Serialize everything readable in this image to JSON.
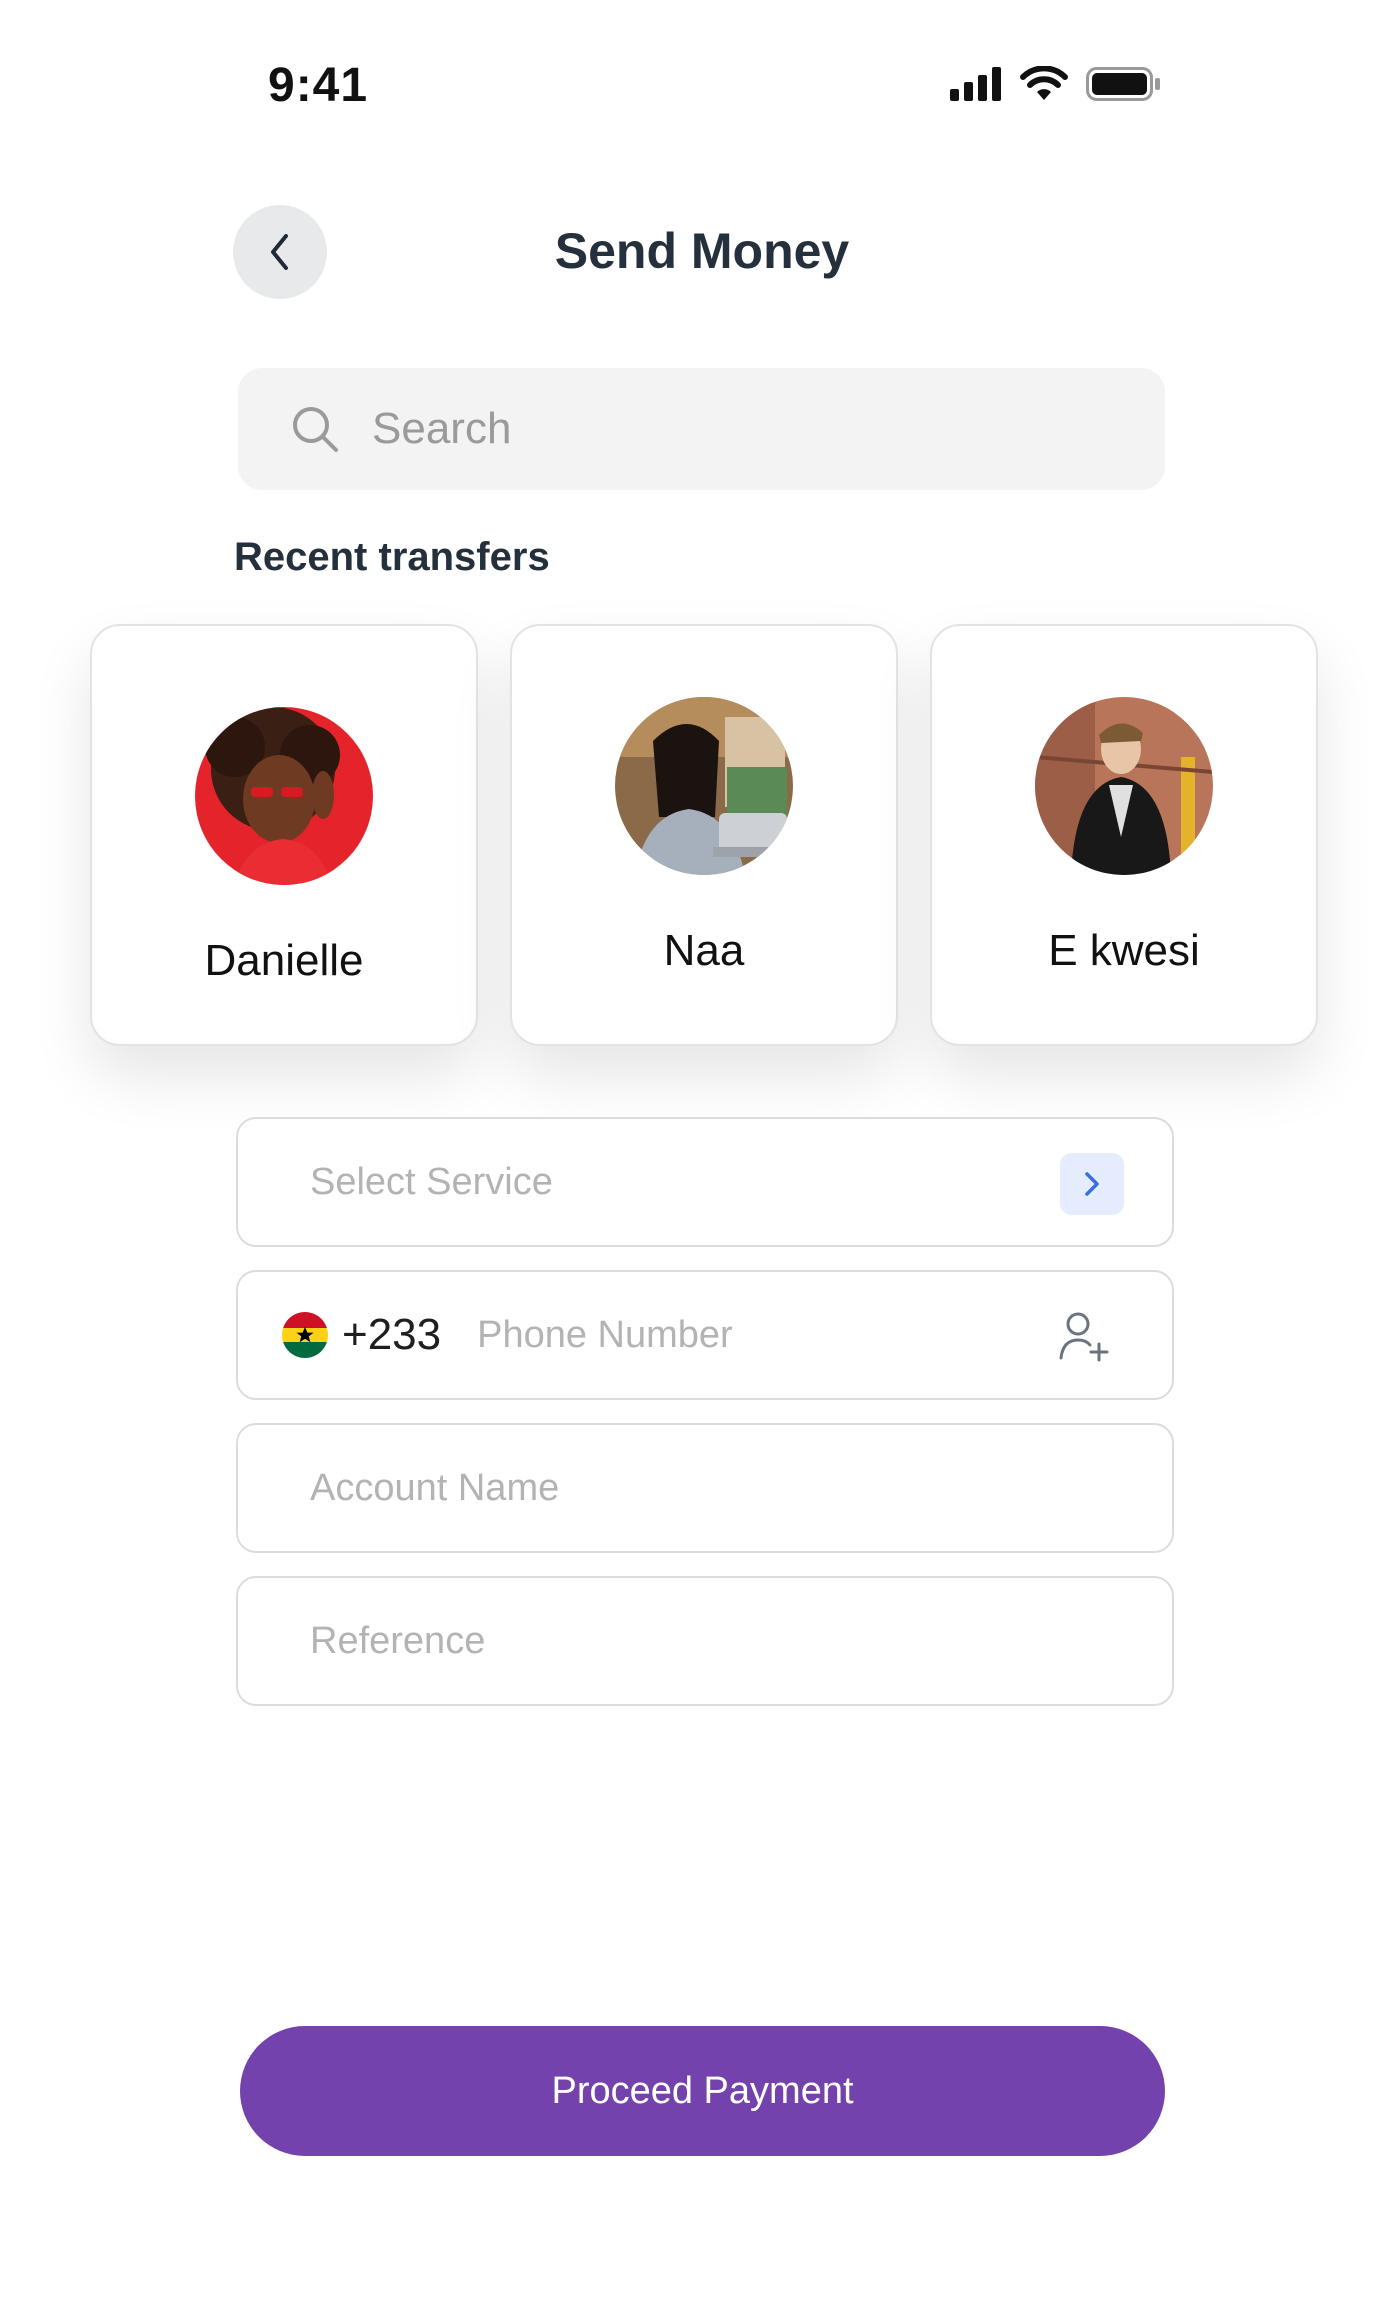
{
  "status_bar": {
    "time": "9:41"
  },
  "header": {
    "title": "Send Money"
  },
  "search": {
    "placeholder": "Search"
  },
  "recent": {
    "title": "Recent transfers",
    "contacts": [
      {
        "name": "Danielle"
      },
      {
        "name": "Naa"
      },
      {
        "name": "E kwesi"
      }
    ]
  },
  "form": {
    "service_placeholder": "Select Service",
    "dial_code": "+233",
    "phone_placeholder": "Phone Number",
    "account_placeholder": "Account Name",
    "reference_placeholder": "Reference"
  },
  "actions": {
    "proceed_label": "Proceed Payment"
  },
  "colors": {
    "accent": "#7442ad",
    "chevron_bg": "#e4ecfd",
    "chevron": "#3b6fe0"
  }
}
